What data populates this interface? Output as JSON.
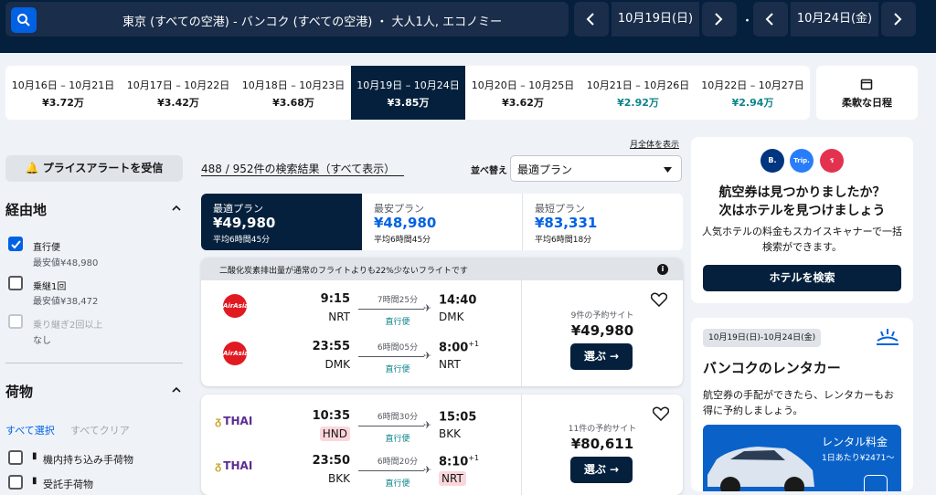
{
  "header": {
    "route": "東京 (すべての空港) - バンコク (すべての空港) ・ 大人1人, エコノミー",
    "outbound_date": "10月19日(日)",
    "return_date": "10月24日(金)",
    "separator": "・"
  },
  "date_options": [
    {
      "range": "10月16日 – 10月21日",
      "price": "¥3.72万",
      "highlight": false
    },
    {
      "range": "10月17日 – 10月22日",
      "price": "¥3.42万",
      "highlight": false
    },
    {
      "range": "10月18日 – 10月23日",
      "price": "¥3.68万",
      "highlight": false
    },
    {
      "range": "10月19日 – 10月24日",
      "price": "¥3.85万",
      "selected": true
    },
    {
      "range": "10月20日 – 10月25日",
      "price": "¥3.62万",
      "highlight": false
    },
    {
      "range": "10月21日 – 10月26日",
      "price": "¥2.92万",
      "highlight": true
    },
    {
      "range": "10月22日 – 10月27日",
      "price": "¥2.94万",
      "highlight": true
    }
  ],
  "flexible_label": "柔軟な日程",
  "filters": {
    "price_alert": "プライスアラートを受信",
    "stops_title": "経由地",
    "stops": [
      {
        "label": "直行便",
        "sub": "最安値¥48,980",
        "checked": true,
        "disabled": false
      },
      {
        "label": "乗継1回",
        "sub": "最安値¥38,472",
        "checked": false,
        "disabled": false
      },
      {
        "label": "乗り継ぎ2回以上",
        "sub": "なし",
        "checked": false,
        "disabled": true
      }
    ],
    "baggage_title": "荷物",
    "select_all": "すべて選択",
    "clear_all": "すべてクリア",
    "baggage": [
      {
        "label": "機内持ち込み手荷物"
      },
      {
        "label": "受託手荷物"
      }
    ]
  },
  "results": {
    "count": "488 / 952件の検索結果（すべて表示）",
    "whole_month": "月全体を表示",
    "sort_label": "並べ替え",
    "sort_value": "最適プラン"
  },
  "sort_tabs": [
    {
      "title": "最適プラン",
      "price": "¥49,980",
      "duration": "平均6時間45分"
    },
    {
      "title": "最安プラン",
      "price": "¥48,980",
      "duration": "平均6時間45分"
    },
    {
      "title": "最短プラン",
      "price": "¥83,331",
      "duration": "平均6時間18分"
    }
  ],
  "flights": [
    {
      "banner": "二酸化炭素排出量が通常のフライトよりも22%少ないフライトです",
      "airline": "AirAsia",
      "legs": [
        {
          "dep_time": "9:15",
          "dep_airport": "NRT",
          "duration": "7時間25分",
          "stops": "直行便",
          "arr_time": "14:40",
          "arr_plus": "",
          "arr_airport": "DMK"
        },
        {
          "dep_time": "23:55",
          "dep_airport": "DMK",
          "duration": "6時間05分",
          "stops": "直行便",
          "arr_time": "8:00",
          "arr_plus": "+1",
          "arr_airport": "NRT"
        }
      ],
      "sites": "9件の予約サイト",
      "price": "¥49,980",
      "select": "選ぶ →"
    },
    {
      "airline": "THAI",
      "legs": [
        {
          "dep_time": "10:35",
          "dep_airport": "HND",
          "duration": "6時間30分",
          "stops": "直行便",
          "arr_time": "15:05",
          "arr_plus": "",
          "arr_airport": "BKK"
        },
        {
          "dep_time": "23:50",
          "dep_airport": "BKK",
          "duration": "6時間20分",
          "stops": "直行便",
          "arr_time": "8:10",
          "arr_plus": "+1",
          "arr_airport": "NRT"
        }
      ],
      "sites": "11件の予約サイト",
      "price": "¥80,611",
      "select": "選ぶ →"
    }
  ],
  "hotel_ad": {
    "logos": [
      "B.",
      "Trip.",
      "ร"
    ],
    "title_line1": "航空券は見つかりましたか？",
    "title_line2": "次はホテルを見つけましょう",
    "desc": "人気ホテルの料金もスカイスキャナーで一括検索ができます。",
    "button": "ホテルを検索"
  },
  "car_ad": {
    "date": "10月19日(日)-10月24日(金)",
    "title": "バンコクのレンタカー",
    "desc": "航空券の手配ができたら、レンタカーもお得に予約しましょう。",
    "rental_label": "レンタル料金",
    "rental_price": "1日あたり¥2471〜"
  },
  "colors": {
    "navy": "#05203c",
    "blue": "#0062e3",
    "teal": "#0c838a"
  }
}
